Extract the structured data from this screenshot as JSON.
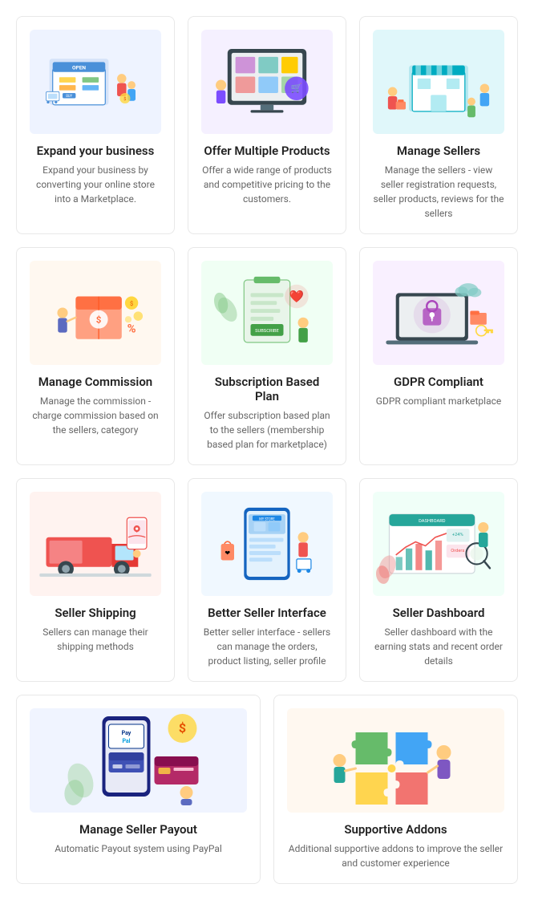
{
  "cards": [
    {
      "id": "expand-business",
      "title": "Expand your business",
      "desc": "Expand your business by converting your online store into a Marketplace.",
      "bg": "#f0f4ff",
      "icon_color": "#4a90d9"
    },
    {
      "id": "offer-multiple-products",
      "title": "Offer Multiple Products",
      "desc": "Offer a wide range of products and competitive pricing to the customers.",
      "bg": "#f5f0ff",
      "icon_color": "#7c4dff"
    },
    {
      "id": "manage-sellers",
      "title": "Manage Sellers",
      "desc": "Manage the sellers - view seller registration requests, seller products, reviews for the sellers",
      "bg": "#e0f7fa",
      "icon_color": "#00acc1"
    },
    {
      "id": "manage-commission",
      "title": "Manage Commission",
      "desc": "Manage the commission - charge commission based on the sellers, category",
      "bg": "#fff8f0",
      "icon_color": "#ff7043"
    },
    {
      "id": "subscription-based-plan",
      "title": "Subscription Based Plan",
      "desc": "Offer subscription based plan to the sellers (membership based plan for marketplace)",
      "bg": "#f0fff4",
      "icon_color": "#43a047"
    },
    {
      "id": "gdpr-compliant",
      "title": "GDPR Compliant",
      "desc": "GDPR compliant marketplace",
      "bg": "#f9f0ff",
      "icon_color": "#ab47bc"
    },
    {
      "id": "seller-shipping",
      "title": "Seller Shipping",
      "desc": "Sellers can manage their shipping methods",
      "bg": "#fff3f0",
      "icon_color": "#ef5350"
    },
    {
      "id": "better-seller-interface",
      "title": "Better Seller Interface",
      "desc": "Better seller interface - sellers can manage the orders, product listing, seller profile",
      "bg": "#f0f8ff",
      "icon_color": "#1e88e5"
    },
    {
      "id": "seller-dashboard",
      "title": "Seller Dashboard",
      "desc": "Seller dashboard with the earning stats and recent order details",
      "bg": "#f0fff8",
      "icon_color": "#26a69a"
    },
    {
      "id": "manage-seller-payout",
      "title": "Manage Seller Payout",
      "desc": "Automatic Payout system using PayPal",
      "bg": "#f0f4ff",
      "icon_color": "#003087"
    },
    {
      "id": "supportive-addons",
      "title": "Supportive Addons",
      "desc": "Additional supportive addons to improve the seller and customer experience",
      "bg": "#fff8f0",
      "icon_color": "#ff9800"
    }
  ]
}
